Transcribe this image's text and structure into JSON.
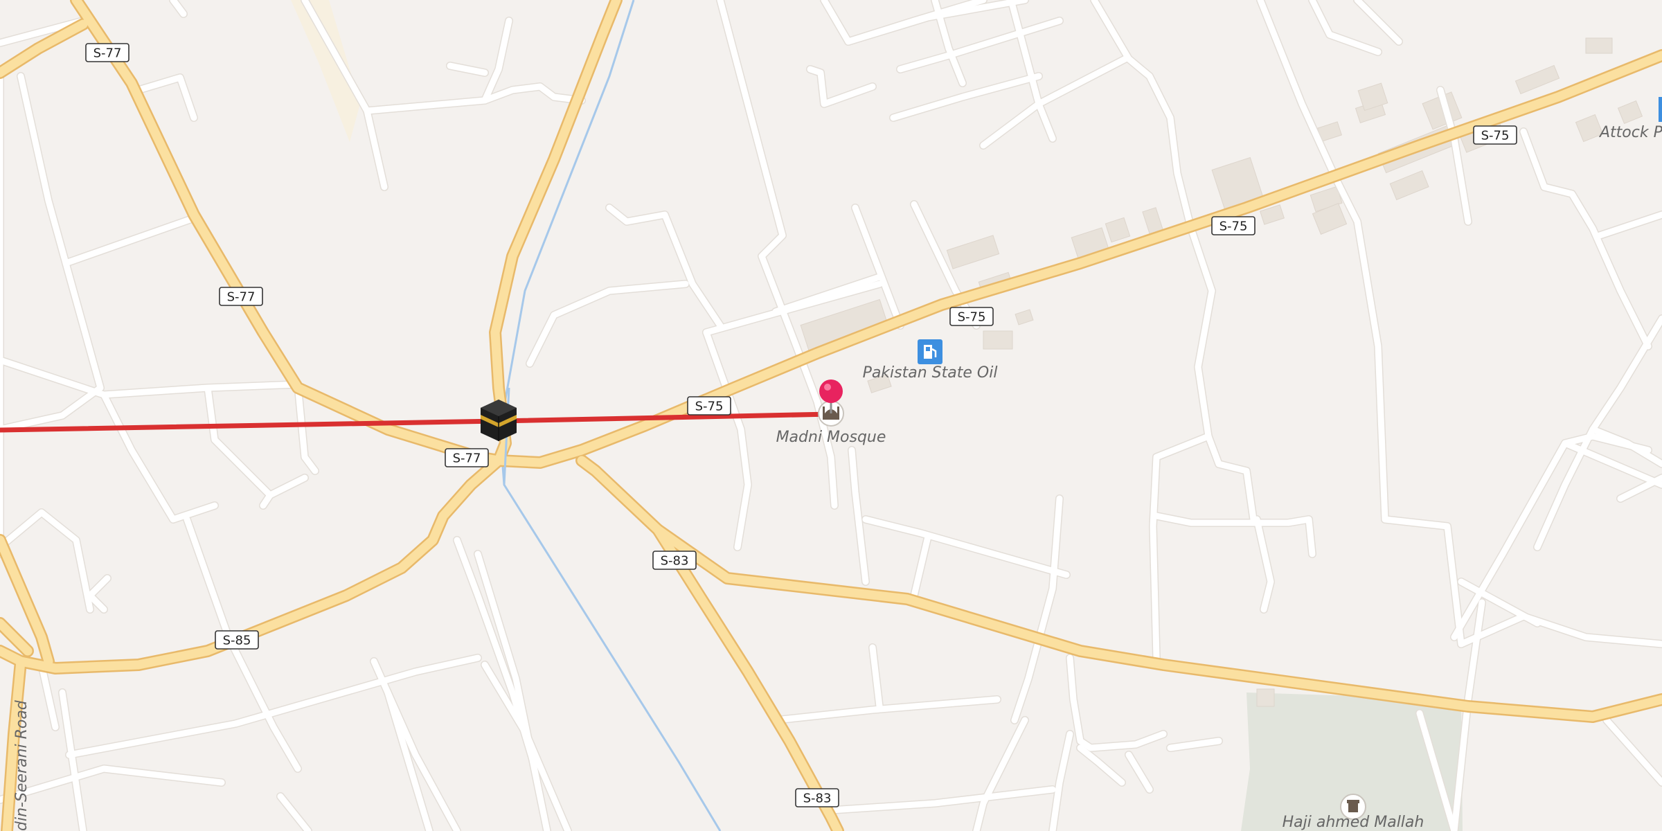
{
  "map": {
    "route_color": "#d93030",
    "pin_color": "#e8235f",
    "fuel_icon_color": "#3d8fe0",
    "park_color": "#e1e4dc",
    "shields": {
      "s77_a": "S-77",
      "s77_b": "S-77",
      "s77_c": "S-77",
      "s75_a": "S-75",
      "s75_b": "S-75",
      "s75_c": "S-75",
      "s75_d": "S-75",
      "s83_a": "S-83",
      "s83_b": "S-83",
      "s85_a": "S-85"
    },
    "labels": {
      "pso": "Pakistan State Oil",
      "mosque": "Madni Mosque",
      "attock": "Attock Pe",
      "haji": "Haji ahmed Mallah",
      "seerani": "din-Seerani Road"
    },
    "icons": {
      "kaaba": "kaaba-icon",
      "fuel": "fuel-station-icon",
      "mosque": "mosque-icon",
      "pin": "map-pin-icon",
      "tomb": "tomb-icon",
      "attock_fuel": "fuel-station-icon"
    }
  }
}
